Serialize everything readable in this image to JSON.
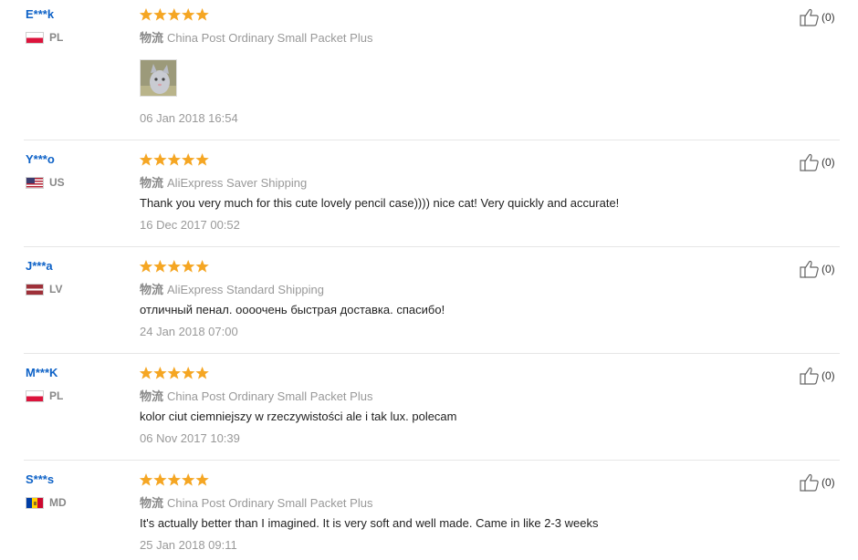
{
  "reviews": [
    {
      "user": "E***k",
      "country": "PL",
      "flag": "pl",
      "rating": 5,
      "shipping_prefix": "物流",
      "shipping": "China Post Ordinary Small Packet Plus",
      "text": "",
      "date": "06 Jan 2018 16:54",
      "helpful": "(0)",
      "has_photo": true
    },
    {
      "user": "Y***o",
      "country": "US",
      "flag": "us",
      "rating": 5,
      "shipping_prefix": "物流",
      "shipping": "AliExpress Saver Shipping",
      "text": "Thank you very much for this cute lovely pencil case)))) nice cat! Very quickly and accurate!",
      "date": "16 Dec 2017 00:52",
      "helpful": "(0)"
    },
    {
      "user": "J***a",
      "country": "LV",
      "flag": "lv",
      "rating": 5,
      "shipping_prefix": "物流",
      "shipping": "AliExpress Standard Shipping",
      "text": "отличный пенал. оооочень быстрая доставка. спасибо!",
      "date": "24 Jan 2018 07:00",
      "helpful": "(0)"
    },
    {
      "user": "M***K",
      "country": "PL",
      "flag": "pl",
      "rating": 5,
      "shipping_prefix": "物流",
      "shipping": "China Post Ordinary Small Packet Plus",
      "text": "kolor ciut ciemniejszy w rzeczywistości ale i tak lux. polecam",
      "date": "06 Nov 2017 10:39",
      "helpful": "(0)"
    },
    {
      "user": "S***s",
      "country": "MD",
      "flag": "md",
      "rating": 5,
      "shipping_prefix": "物流",
      "shipping": "China Post Ordinary Small Packet Plus",
      "text": "It's actually better than I imagined. It is very soft and well made. Came in like 2-3 weeks",
      "date": "25 Jan 2018 09:11",
      "helpful": "(0)"
    }
  ],
  "colors": {
    "username": "#0e62c7",
    "star": "#f5a623",
    "muted": "#999999"
  },
  "icons": {
    "helpful": "thumbs-up-icon",
    "rating": "star-icon"
  }
}
